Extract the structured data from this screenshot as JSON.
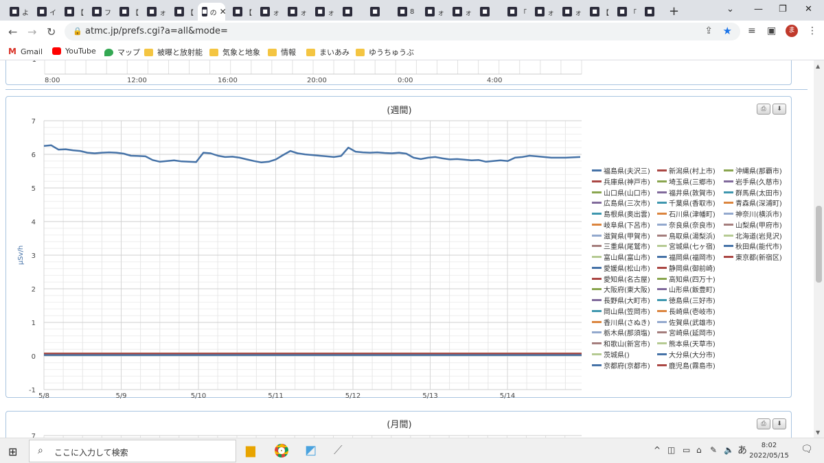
{
  "tabs": [
    {
      "title": "よ"
    },
    {
      "title": "イ"
    },
    {
      "title": "【"
    },
    {
      "title": "フ"
    },
    {
      "title": "【"
    },
    {
      "title": "ォ"
    },
    {
      "title": "【"
    },
    {
      "title": "の",
      "active": true
    },
    {
      "title": "【"
    },
    {
      "title": "ォ"
    },
    {
      "title": "ォ"
    },
    {
      "title": "ォ"
    },
    {
      "title": ""
    },
    {
      "title": ""
    },
    {
      "title": "8"
    },
    {
      "title": "ォ"
    },
    {
      "title": "ォ"
    },
    {
      "title": ""
    },
    {
      "title": "「"
    },
    {
      "title": "ォ"
    },
    {
      "title": "ォ"
    },
    {
      "title": "【"
    },
    {
      "title": "「"
    },
    {
      "title": ""
    }
  ],
  "browser": {
    "url": "atmc.jp/prefs.cgi?a=all&mode=",
    "new_tab": "+",
    "avatar_letter": "ま"
  },
  "bookmarks": [
    {
      "label": "Gmail",
      "icon": "gmail-icon"
    },
    {
      "label": "YouTube",
      "icon": "youtube-icon"
    },
    {
      "label": "マップ",
      "icon": "maps-icon"
    },
    {
      "label": "被曝と放射能",
      "icon": "folder-icon"
    },
    {
      "label": "気象と地象",
      "icon": "folder-icon"
    },
    {
      "label": "情報",
      "icon": "folder-icon"
    },
    {
      "label": "まいあみ",
      "icon": "folder-icon"
    },
    {
      "label": "ゆうちゅうぶ",
      "icon": "folder-icon"
    }
  ],
  "top_chart_fragment": {
    "y_label": "-1",
    "x_labels": [
      "8:00",
      "12:00",
      "16:00",
      "20:00",
      "0:00",
      "4:00"
    ]
  },
  "weekly": {
    "title": "(週間)",
    "print_icon": "print-icon",
    "download_icon": "download-icon"
  },
  "monthly": {
    "title": "(月間)",
    "y_top": "7"
  },
  "chart_data": {
    "type": "line",
    "title": "(週間)",
    "ylabel": "μSv/h",
    "xlabel": "",
    "ylim": [
      -1,
      7
    ],
    "y_ticks": [
      7,
      6,
      5,
      4,
      3,
      2,
      1,
      0,
      -1
    ],
    "x_ticks": [
      "5/8",
      "5/9",
      "5/10",
      "5/11",
      "5/12",
      "5/13",
      "5/14"
    ],
    "grid": true,
    "legend_placement": "right",
    "series": [
      {
        "name": "福島県(夫沢三)",
        "color": "#4572a7",
        "values": [
          6.25,
          6.27,
          6.14,
          6.15,
          6.12,
          6.1,
          6.05,
          6.03,
          6.05,
          6.06,
          6.05,
          6.02,
          5.96,
          5.95,
          5.94,
          5.83,
          5.78,
          5.8,
          5.82,
          5.79,
          5.78,
          5.77,
          6.05,
          6.03,
          5.96,
          5.92,
          5.93,
          5.9,
          5.85,
          5.8,
          5.76,
          5.78,
          5.85,
          5.98,
          6.1,
          6.03,
          6.0,
          5.98,
          5.96,
          5.94,
          5.92,
          5.95,
          6.2,
          6.08,
          6.06,
          6.05,
          6.06,
          6.04,
          6.03,
          6.05,
          6.02,
          5.9,
          5.86,
          5.9,
          5.92,
          5.88,
          5.85,
          5.86,
          5.84,
          5.82,
          5.83,
          5.78,
          5.8,
          5.82,
          5.8,
          5.9,
          5.92,
          5.96,
          5.94,
          5.92,
          5.9,
          5.9,
          5.9,
          5.91,
          5.92
        ]
      },
      {
        "name": "新潟県(村上市)",
        "color": "#aa4643"
      },
      {
        "name": "沖縄県(那覇市)",
        "color": "#89a54e"
      },
      {
        "name": "兵庫県(神戸市)",
        "color": "#aa4643"
      },
      {
        "name": "埼玉県(三郷市)",
        "color": "#89a54e"
      },
      {
        "name": "岩手県(久慈市)",
        "color": "#80699b"
      },
      {
        "name": "山口県(山口市)",
        "color": "#89a54e"
      },
      {
        "name": "福井県(敦賀市)",
        "color": "#80699b"
      },
      {
        "name": "群馬県(太田市)",
        "color": "#3d96ae"
      },
      {
        "name": "広島県(三次市)",
        "color": "#80699b"
      },
      {
        "name": "千葉県(香取市)",
        "color": "#3d96ae"
      },
      {
        "name": "青森県(深浦町)",
        "color": "#db843d"
      },
      {
        "name": "島根県(奥出雲)",
        "color": "#3d96ae"
      },
      {
        "name": "石川県(津幡町)",
        "color": "#db843d"
      },
      {
        "name": "神奈川(横浜市)",
        "color": "#92a8cd"
      },
      {
        "name": "岐阜県(下呂市)",
        "color": "#db843d"
      },
      {
        "name": "奈良県(奈良市)",
        "color": "#92a8cd"
      },
      {
        "name": "山梨県(甲府市)",
        "color": "#a47d7c"
      },
      {
        "name": "滋賀県(甲賀市)",
        "color": "#92a8cd"
      },
      {
        "name": "鳥取県(湯梨浜)",
        "color": "#a47d7c"
      },
      {
        "name": "北海道(岩見沢)",
        "color": "#b5ca92"
      },
      {
        "name": "三重県(尾鷲市)",
        "color": "#a47d7c"
      },
      {
        "name": "宮城県(七ヶ宿)",
        "color": "#b5ca92"
      },
      {
        "name": "秋田県(能代市)",
        "color": "#4572a7"
      },
      {
        "name": "富山県(富山市)",
        "color": "#b5ca92"
      },
      {
        "name": "福岡県(福岡市)",
        "color": "#4572a7"
      },
      {
        "name": "東京都(新宿区)",
        "color": "#aa4643"
      },
      {
        "name": "愛媛県(松山市)",
        "color": "#4572a7"
      },
      {
        "name": "静岡県(御前崎)",
        "color": "#aa4643"
      },
      {
        "name": "愛知県(名古屋)",
        "color": "#aa4643"
      },
      {
        "name": "高知県(四万十)",
        "color": "#89a54e"
      },
      {
        "name": "大阪府(東大阪)",
        "color": "#89a54e"
      },
      {
        "name": "山形県(飯豊町)",
        "color": "#80699b"
      },
      {
        "name": "長野県(大町市)",
        "color": "#80699b"
      },
      {
        "name": "徳島県(三好市)",
        "color": "#3d96ae"
      },
      {
        "name": "岡山県(笠岡市)",
        "color": "#3d96ae"
      },
      {
        "name": "長崎県(壱岐市)",
        "color": "#db843d"
      },
      {
        "name": "香川県(さぬき)",
        "color": "#db843d"
      },
      {
        "name": "佐賀県(武雄市)",
        "color": "#92a8cd"
      },
      {
        "name": "栃木県(那須塩)",
        "color": "#92a8cd"
      },
      {
        "name": "宮崎県(延岡市)",
        "color": "#a47d7c"
      },
      {
        "name": "和歌山(新宮市)",
        "color": "#a47d7c"
      },
      {
        "name": "熊本県(天草市)",
        "color": "#b5ca92"
      },
      {
        "name": "茨城県()",
        "color": "#b5ca92"
      },
      {
        "name": "大分県(大分市)",
        "color": "#4572a7"
      },
      {
        "name": "京都府(京都市)",
        "color": "#4572a7"
      },
      {
        "name": "鹿児島(霧島市)",
        "color": "#aa4643"
      }
    ],
    "other_series_level": 0.05
  },
  "taskbar": {
    "search_placeholder": "ここに入力して検索",
    "time": "8:02",
    "date": "2022/05/15",
    "ime": "あ",
    "notif_count": "1"
  }
}
